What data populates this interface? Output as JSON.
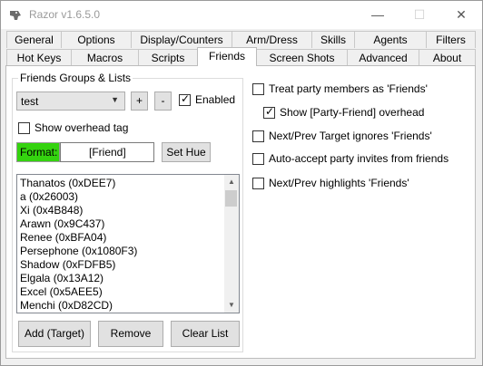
{
  "window": {
    "title": "Razor v1.6.5.0"
  },
  "tabs_row1": [
    {
      "label": "General"
    },
    {
      "label": "Options"
    },
    {
      "label": "Display/Counters"
    },
    {
      "label": "Arm/Dress"
    },
    {
      "label": "Skills"
    },
    {
      "label": "Agents"
    },
    {
      "label": "Filters"
    }
  ],
  "tabs_row2": [
    {
      "label": "Hot Keys"
    },
    {
      "label": "Macros"
    },
    {
      "label": "Scripts"
    },
    {
      "label": "Friends"
    },
    {
      "label": "Screen Shots"
    },
    {
      "label": "Advanced"
    },
    {
      "label": "About"
    }
  ],
  "active_tab": "Friends",
  "friends_group": {
    "title": "Friends Groups & Lists",
    "selected_group": "test",
    "add_label": "+",
    "remove_label": "-",
    "enabled_label": "Enabled",
    "enabled_checked": true,
    "show_overhead_label": "Show overhead tag",
    "show_overhead_checked": false,
    "format_label": "Format:",
    "format_value": "[Friend]",
    "format_color": "#34d30f",
    "set_hue_label": "Set Hue",
    "friends": [
      "Thanatos (0xDEE7)",
      "a (0x26003)",
      "Xi (0x4B848)",
      "Arawn (0x9C437)",
      "Renee (0xBFA04)",
      "Persephone (0x1080F3)",
      "Shadow (0xFDFB5)",
      "Elgala (0x13A12)",
      "Excel (0x5AEE5)",
      "Menchi (0xD82CD)"
    ],
    "add_target_label": "Add (Target)",
    "remove_label_btn": "Remove",
    "clear_list_label": "Clear List"
  },
  "options": {
    "treat_party": {
      "label": "Treat party members as 'Friends'",
      "checked": false
    },
    "show_party_overhead": {
      "label": "Show [Party-Friend] overhead",
      "checked": true
    },
    "next_prev_target": {
      "label": "Next/Prev Target ignores 'Friends'",
      "checked": false
    },
    "auto_accept": {
      "label": "Auto-accept party invites from friends",
      "checked": false
    },
    "next_prev_highlights": {
      "label": "Next/Prev highlights 'Friends'",
      "checked": false
    }
  }
}
